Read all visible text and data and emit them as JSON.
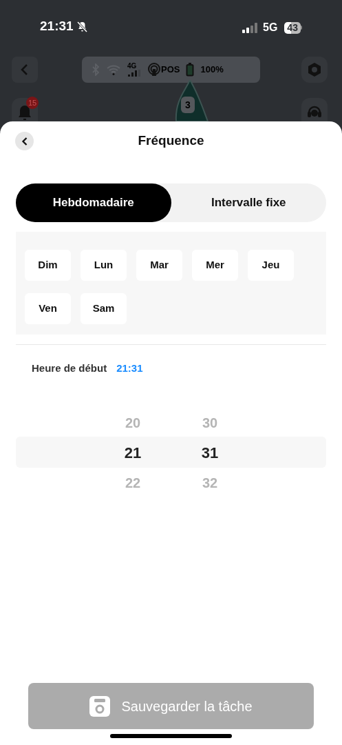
{
  "status_bar": {
    "time": "21:31",
    "network": "5G",
    "battery": "43"
  },
  "background_app": {
    "toolbar": {
      "cellular": "4G",
      "pos": "POS",
      "battery": "100%"
    },
    "notification_count": "15",
    "map_badge": "3"
  },
  "sheet": {
    "title": "Fréquence",
    "tabs": [
      {
        "label": "Hebdomadaire",
        "selected": true
      },
      {
        "label": "Intervalle fixe",
        "selected": false
      }
    ],
    "days": [
      {
        "label": "Dim",
        "selected": false
      },
      {
        "label": "Lun",
        "selected": false
      },
      {
        "label": "Mar",
        "selected": false
      },
      {
        "label": "Mer",
        "selected": false
      },
      {
        "label": "Jeu",
        "selected": false
      },
      {
        "label": "Ven",
        "selected": false
      },
      {
        "label": "Sam",
        "selected": false
      }
    ],
    "start_time": {
      "label": "Heure de début",
      "value": "21:31"
    },
    "picker": {
      "hours": [
        {
          "value": "20",
          "selected": false
        },
        {
          "value": "21",
          "selected": true
        },
        {
          "value": "22",
          "selected": false
        }
      ],
      "minutes": [
        {
          "value": "30",
          "selected": false
        },
        {
          "value": "31",
          "selected": true
        },
        {
          "value": "32",
          "selected": false
        }
      ]
    },
    "save_button": {
      "label": "Sauvegarder la tâche",
      "disabled": true
    }
  }
}
